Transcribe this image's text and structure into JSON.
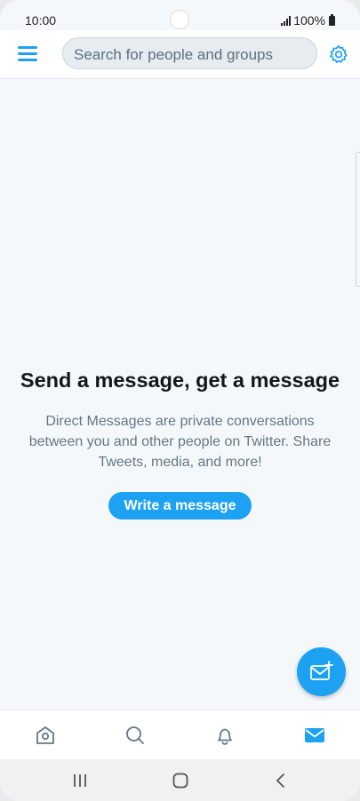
{
  "status_bar": {
    "time": "10:00",
    "battery_text": "100%"
  },
  "app_bar": {
    "menu_icon": "hamburger-icon",
    "search_placeholder": "Search for people and groups",
    "settings_icon": "gear-icon"
  },
  "empty_state": {
    "title": "Send a message, get a message",
    "description": "Direct Messages are private conversations between you and other people on Twitter. Share Tweets, media, and more!",
    "button_label": "Write a message"
  },
  "fab": {
    "icon": "new-message-icon"
  },
  "tab_bar": {
    "tabs": [
      {
        "name": "home",
        "icon": "home-icon",
        "active": false
      },
      {
        "name": "search",
        "icon": "search-icon",
        "active": false
      },
      {
        "name": "notifications",
        "icon": "bell-icon",
        "active": false
      },
      {
        "name": "messages",
        "icon": "mail-icon",
        "active": true
      }
    ]
  },
  "system_nav": {
    "buttons": [
      "recent-apps-icon",
      "home-button-icon",
      "back-icon"
    ]
  },
  "colors": {
    "accent": "#1da1f2",
    "background": "#f5f8fa",
    "text_primary": "#14171a",
    "text_secondary": "#657786"
  }
}
